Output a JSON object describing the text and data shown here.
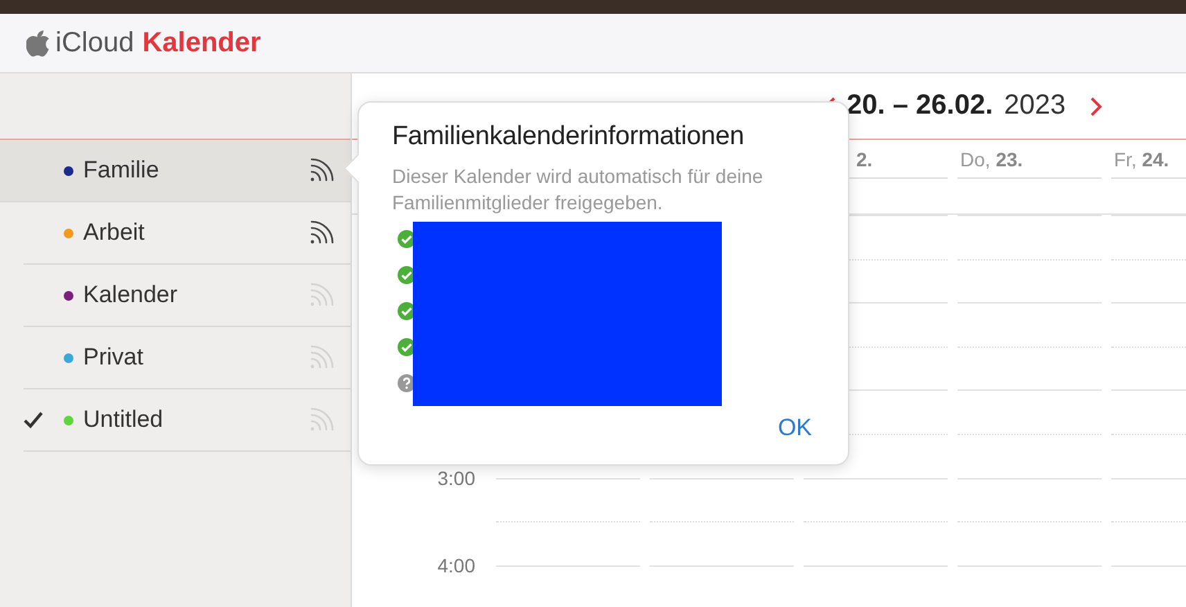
{
  "app": {
    "brand": "iCloud",
    "title": "Kalender"
  },
  "sidebar": {
    "calendars": [
      {
        "name": "Familie",
        "color": "#1c2a8c",
        "selected": true,
        "checked": false,
        "shared": true
      },
      {
        "name": "Arbeit",
        "color": "#f39a1e",
        "selected": false,
        "checked": false,
        "shared": true
      },
      {
        "name": "Kalender",
        "color": "#7b1f7c",
        "selected": false,
        "checked": false,
        "shared": false
      },
      {
        "name": "Privat",
        "color": "#3aa8dd",
        "selected": false,
        "checked": false,
        "shared": false
      },
      {
        "name": "Untitled",
        "color": "#5fd63d",
        "selected": false,
        "checked": true,
        "shared": false
      }
    ]
  },
  "week": {
    "range": "20. – 26.02.",
    "year": "2023",
    "days": [
      {
        "label": "**2.**"
      },
      {
        "label": "Do, **23.**"
      },
      {
        "label": "Fr, **24.**"
      }
    ],
    "times": [
      "3:00",
      "4:00"
    ]
  },
  "popover": {
    "title": "Familienkalenderinformationen",
    "text": "Dieser Kalender wird automatisch für deine Familienmitglieder freigegeben.",
    "members": [
      {
        "accepted": true
      },
      {
        "accepted": true
      },
      {
        "accepted": true
      },
      {
        "accepted": true
      },
      {
        "accepted": false
      }
    ],
    "button": "OK"
  }
}
